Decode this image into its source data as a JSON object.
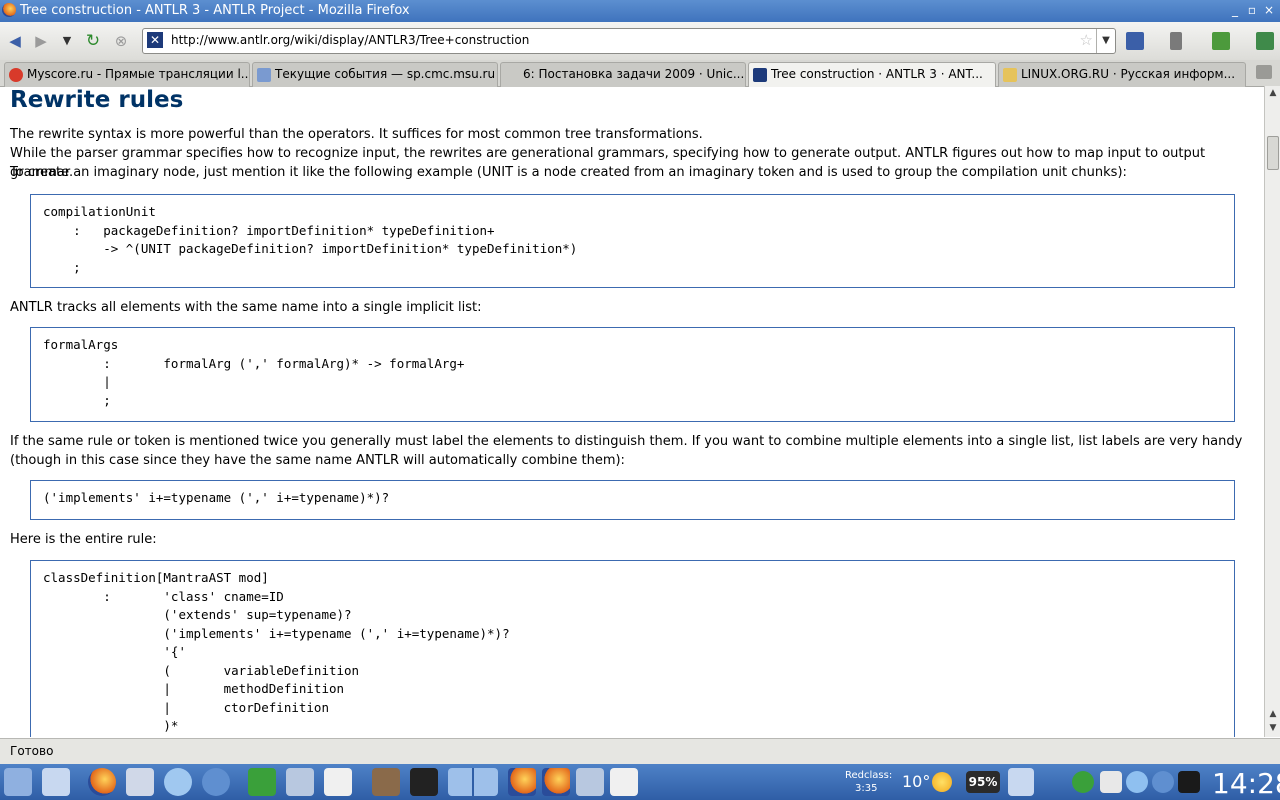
{
  "window": {
    "title": "Tree construction - ANTLR 3 - ANTLR Project - Mozilla Firefox"
  },
  "navbar": {
    "url": "http://www.antlr.org/wiki/display/ANTLR3/Tree+construction",
    "back_icon": "back-arrow-icon",
    "forward_icon": "forward-arrow-icon",
    "reload_icon": "reload-icon",
    "stop_icon": "stop-icon"
  },
  "tabs": [
    {
      "label": "Myscore.ru - Прямые трансляции l..."
    },
    {
      "label": "Текущие события — sp.cmc.msu.ru"
    },
    {
      "label": "6: Постановка задачи 2009 · Unic..."
    },
    {
      "label": "Tree construction · ANTLR 3 · ANT..."
    },
    {
      "label": "LINUX.ORG.RU · Русская информ..."
    }
  ],
  "page": {
    "heading": "Rewrite rules",
    "p1": "The rewrite syntax is more powerful than the operators. It suffices for most common tree transformations.",
    "p2": "While the parser grammar specifies how to recognize input, the rewrites are generational grammars, specifying how to generate output. ANTLR figures out how to map input to output grammar.",
    "p3": "To create an imaginary node, just mention it like the following example (UNIT is a node created from an imaginary token and is used to group the compilation unit chunks):",
    "code1": "compilationUnit\n    :   packageDefinition? importDefinition* typeDefinition+\n        -> ^(UNIT packageDefinition? importDefinition* typeDefinition*)\n    ;",
    "p4": "ANTLR tracks all elements with the same name into a single implicit list:",
    "code2": "formalArgs\n        :       formalArg (',' formalArg)* -> formalArg+\n        |\n        ;",
    "p5": "If the same rule or token is mentioned twice you generally must label the elements to distinguish them. If you want to combine multiple elements into a single list, list labels are very handy",
    "p6": "(though in this case since they have the same name ANTLR will automatically combine them):",
    "code3": "('implements' i+=typename (',' i+=typename)*)?",
    "p7": "Here is the entire rule:",
    "code4": "classDefinition[MantraAST mod]\n        :       'class' cname=ID\n                ('extends' sup=typename)?\n                ('implements' i+=typename (',' i+=typename)*)?\n                '{'\n                (       variableDefinition\n                |       methodDefinition\n                |       ctorDefinition\n                )*\n                '}'"
  },
  "status": {
    "text": "Готово"
  },
  "taskbar": {
    "weather_label": "Redclass:",
    "weather_time": "3:35",
    "temperature": "10°",
    "battery": "95%",
    "clock": "14:28"
  }
}
